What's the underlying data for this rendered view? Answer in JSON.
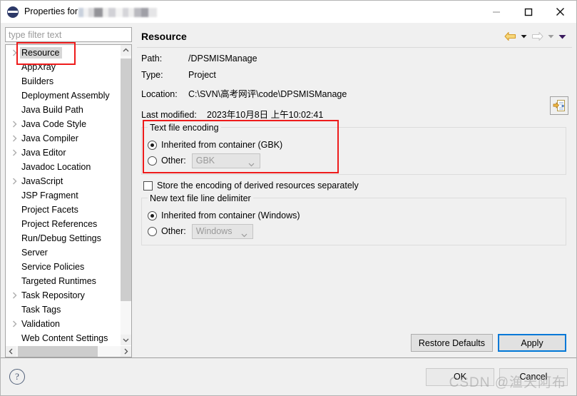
{
  "window": {
    "title_prefix": "Properties for",
    "title_redacted": true,
    "minimize_label": "Minimize",
    "maximize_label": "Maximize",
    "close_label": "Close"
  },
  "sidebar": {
    "filter_placeholder": "type filter text",
    "filter_value": "",
    "items": [
      {
        "label": "Resource",
        "expandable": true,
        "selected": true
      },
      {
        "label": "AppXray",
        "expandable": false,
        "selected": false
      },
      {
        "label": "Builders",
        "expandable": false,
        "selected": false
      },
      {
        "label": "Deployment Assembly",
        "expandable": false,
        "selected": false
      },
      {
        "label": "Java Build Path",
        "expandable": false,
        "selected": false
      },
      {
        "label": "Java Code Style",
        "expandable": true,
        "selected": false
      },
      {
        "label": "Java Compiler",
        "expandable": true,
        "selected": false
      },
      {
        "label": "Java Editor",
        "expandable": true,
        "selected": false
      },
      {
        "label": "Javadoc Location",
        "expandable": false,
        "selected": false
      },
      {
        "label": "JavaScript",
        "expandable": true,
        "selected": false
      },
      {
        "label": "JSP Fragment",
        "expandable": false,
        "selected": false
      },
      {
        "label": "Project Facets",
        "expandable": false,
        "selected": false
      },
      {
        "label": "Project References",
        "expandable": false,
        "selected": false
      },
      {
        "label": "Run/Debug Settings",
        "expandable": false,
        "selected": false
      },
      {
        "label": "Server",
        "expandable": false,
        "selected": false
      },
      {
        "label": "Service Policies",
        "expandable": false,
        "selected": false
      },
      {
        "label": "Targeted Runtimes",
        "expandable": false,
        "selected": false
      },
      {
        "label": "Task Repository",
        "expandable": true,
        "selected": false
      },
      {
        "label": "Task Tags",
        "expandable": false,
        "selected": false
      },
      {
        "label": "Validation",
        "expandable": true,
        "selected": false
      },
      {
        "label": "Web Content Settings",
        "expandable": false,
        "selected": false
      }
    ]
  },
  "page": {
    "title": "Resource",
    "nav": {
      "back_label": "Back",
      "back_menu_label": "Back history",
      "forward_label": "Forward",
      "forward_menu_label": "Forward history",
      "view_menu_label": "View menu"
    },
    "fields": {
      "path_label": "Path:",
      "path_value": "/DPSMISManage",
      "type_label": "Type:",
      "type_value": "Project",
      "location_label": "Location:",
      "location_value": "C:\\SVN\\高考网评\\code\\DPSMISManage",
      "last_modified_label": "Last modified:",
      "last_modified_value": "2023年10月8日 上午10:02:41",
      "browse_label": "Edit location"
    },
    "encoding_group": {
      "title": "Text file encoding",
      "inherited_label": "Inherited from container (GBK)",
      "inherited_selected": true,
      "other_label": "Other:",
      "other_selected": false,
      "other_value": "GBK",
      "other_enabled": false
    },
    "derived_checkbox": {
      "label": "Store the encoding of derived resources separately",
      "checked": false
    },
    "delimiter_group": {
      "title": "New text file line delimiter",
      "inherited_label": "Inherited from container (Windows)",
      "inherited_selected": true,
      "other_label": "Other:",
      "other_selected": false,
      "other_value": "Windows",
      "other_enabled": false
    }
  },
  "buttons": {
    "restore_defaults": "Restore Defaults",
    "apply": "Apply",
    "apply_focused": true,
    "ok": "OK",
    "cancel": "Cancel",
    "help": "?"
  },
  "watermark": {
    "text": "CSDN @渔天阿布"
  },
  "colors": {
    "dialog_bg": "#f0f0f0",
    "annotation_red": "#ee1b1b",
    "focus_blue": "#0078d7",
    "selection_gray": "#d6d6d6",
    "nav_arrow_active": "#e8a33d"
  }
}
